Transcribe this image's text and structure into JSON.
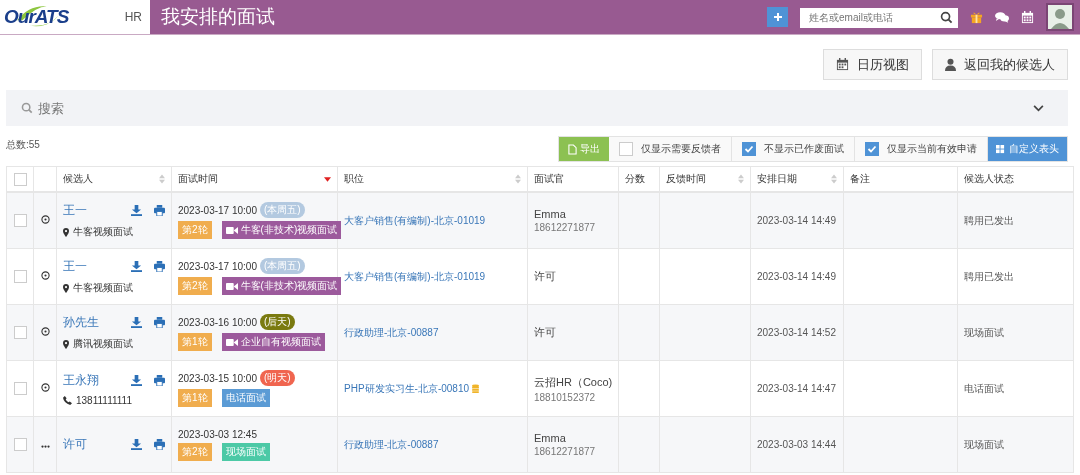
{
  "header": {
    "logo": "OurATS",
    "module": "HR",
    "title": "我安排的面试",
    "search": {
      "placeholder": "姓名或email或电话"
    }
  },
  "actions": [
    {
      "kind": "calendar",
      "label": "日历视图"
    },
    {
      "kind": "person",
      "label": "返回我的候选人"
    }
  ],
  "search_bar": {
    "placeholder": "搜索"
  },
  "total": "总数:55",
  "toolbar": {
    "export": "导出",
    "filters": [
      {
        "label": "仅显示需要反馈者",
        "checked": false
      },
      {
        "label": "不显示已作废面试",
        "checked": true
      },
      {
        "label": "仅显示当前有效申请",
        "checked": true
      }
    ],
    "customize": "自定义表头"
  },
  "table": {
    "header_checked": false,
    "columns": [
      {
        "label": "候选人",
        "kind": "sortable"
      },
      {
        "label": "面试时间",
        "kind": "desc"
      },
      {
        "label": "职位",
        "kind": "sortable"
      },
      {
        "label": "面试官",
        "kind": "plain"
      },
      {
        "label": "分数",
        "kind": "plain"
      },
      {
        "label": "反馈时间",
        "kind": "sortable"
      },
      {
        "label": "安排日期",
        "kind": "sortable"
      },
      {
        "label": "备注",
        "kind": "plain"
      },
      {
        "label": "候选人状态",
        "kind": "plain"
      }
    ],
    "rows": [
      {
        "checked": false,
        "kind": "clock",
        "name": "王一",
        "contact": {
          "kind": "location",
          "text": "牛客视频面试"
        },
        "time": "2023-03-17 10:00",
        "day_tag": {
          "text": "(本周五)",
          "color": "#b3c9e0"
        },
        "round": "第2轮",
        "type": {
          "text": "牛客(非技术)视频面试",
          "color": "#9c5a9c",
          "video": true
        },
        "position": "大客户销售(有编制)-北京-01019",
        "coin": false,
        "interviewer": "Emma",
        "interviewer_phone": "18612271877",
        "date": "2023-03-14 14:49",
        "status": "聘用已发出"
      },
      {
        "checked": false,
        "kind": "clock",
        "name": "王一",
        "contact": {
          "kind": "location",
          "text": "牛客视频面试"
        },
        "time": "2023-03-17 10:00",
        "day_tag": {
          "text": "(本周五)",
          "color": "#b3c9e0"
        },
        "round": "第2轮",
        "type": {
          "text": "牛客(非技术)视频面试",
          "color": "#9c5a9c",
          "video": true
        },
        "position": "大客户销售(有编制)-北京-01019",
        "coin": false,
        "interviewer": "许可",
        "date": "2023-03-14 14:49",
        "status": "聘用已发出"
      },
      {
        "checked": false,
        "kind": "clock",
        "name": "孙先生",
        "contact": {
          "kind": "location",
          "text": "腾讯视频面试"
        },
        "time": "2023-03-16 10:00",
        "day_tag": {
          "text": "(后天)",
          "color": "#7a7a10"
        },
        "round": "第1轮",
        "type": {
          "text": "企业自有视频面试",
          "color": "#9c5a9c",
          "video": true
        },
        "position": "行政助理-北京-00887",
        "coin": false,
        "interviewer": "许可",
        "date": "2023-03-14 14:52",
        "status": "现场面试"
      },
      {
        "checked": false,
        "kind": "clock",
        "name": "王永翔",
        "contact": {
          "kind": "phone",
          "text": "13811111111"
        },
        "time": "2023-03-15 10:00",
        "day_tag": {
          "text": "(明天)",
          "color": "#f0654f"
        },
        "round": "第1轮",
        "type": {
          "text": "电话面试",
          "color": "#5b9bd5",
          "video": false
        },
        "position": "PHP研发实习生-北京-00810",
        "coin": true,
        "interviewer": "云招HR（Coco)",
        "interviewer_phone": "18810152372",
        "date": "2023-03-14 14:47",
        "status": "电话面试"
      },
      {
        "checked": false,
        "kind": "more",
        "name": "许可",
        "time": "2023-03-03 12:45",
        "round": "第2轮",
        "type": {
          "text": "现场面试",
          "color": "#4cc9a6",
          "video": false
        },
        "position": "行政助理-北京-00887",
        "coin": false,
        "interviewer": "Emma",
        "interviewer_phone": "18612271877",
        "date": "2023-03-03 14:44",
        "status": "现场面试"
      }
    ]
  }
}
